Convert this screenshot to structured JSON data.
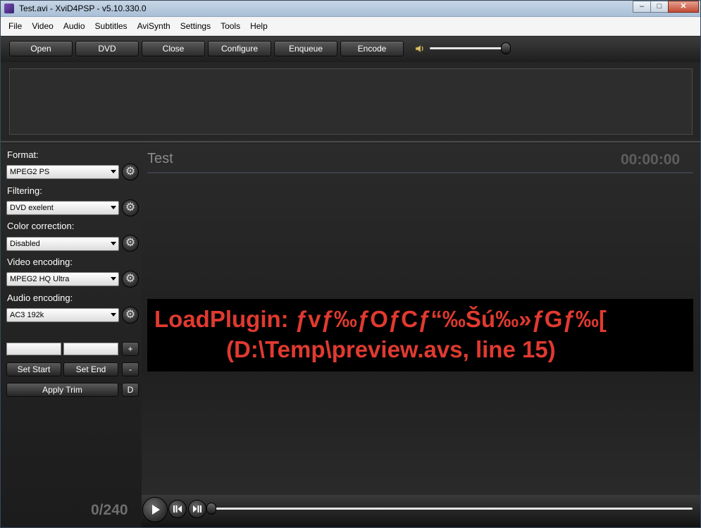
{
  "window": {
    "title": "Test.avi  - XviD4PSP - v5.10.330.0",
    "minimize_glyph": "–",
    "maximize_glyph": "□",
    "close_glyph": "✕"
  },
  "menu": [
    "File",
    "Video",
    "Audio",
    "Subtitles",
    "AviSynth",
    "Settings",
    "Tools",
    "Help"
  ],
  "toolbar": {
    "buttons": [
      "Open",
      "DVD",
      "Close",
      "Configure",
      "Enqueue",
      "Encode"
    ],
    "volume_icon": "speaker-icon",
    "volume_level": 0.9
  },
  "settings": {
    "format": {
      "label": "Format:",
      "value": "MPEG2 PS"
    },
    "filtering": {
      "label": "Filtering:",
      "value": "DVD exelent"
    },
    "color_correction": {
      "label": "Color correction:",
      "value": "Disabled"
    },
    "video_encoding": {
      "label": "Video encoding:",
      "value": "MPEG2 HQ Ultra"
    },
    "audio_encoding": {
      "label": "Audio encoding:",
      "value": "AC3 192k"
    }
  },
  "trim": {
    "start_value": "",
    "end_value": "",
    "plus_label": "+",
    "minus_label": "-",
    "set_start_label": "Set Start",
    "set_end_label": "Set End",
    "apply_trim_label": "Apply Trim",
    "d_label": "D"
  },
  "counter": "0/240",
  "preview": {
    "title": "Test",
    "time": "00:00:00",
    "error_line1": "LoadPlugin: ƒvƒ‰ƒOƒCƒ“‰Šú‰»ƒGƒ‰[",
    "error_line2": "(D:\\Temp\\preview.avs, line 15)"
  },
  "player": {
    "play_icon": "play-icon",
    "prev_frame_icon": "previous-frame-icon",
    "next_frame_icon": "next-frame-icon",
    "position": 0
  }
}
